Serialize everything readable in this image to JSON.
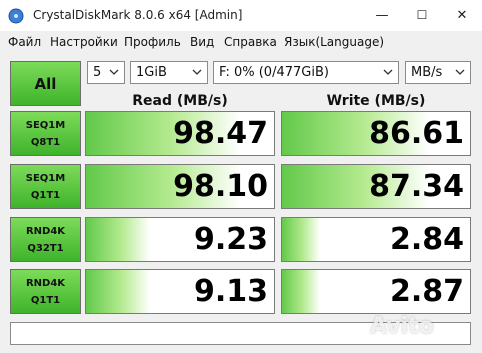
{
  "window": {
    "title": "CrystalDiskMark 8.0.6 x64 [Admin]",
    "minimize": "—",
    "maximize": "☐",
    "close": "✕"
  },
  "menu": [
    {
      "label": "Файл"
    },
    {
      "label": "Настройки"
    },
    {
      "label": "Профиль"
    },
    {
      "label": "Вид"
    },
    {
      "label": "Справка"
    },
    {
      "label": "Язык(Language)"
    }
  ],
  "controls": {
    "all_label": "All",
    "count": "5",
    "size": "1GiB",
    "drive": "F: 0% (0/477GiB)",
    "unit": "MB/s"
  },
  "headers": {
    "read": "Read (MB/s)",
    "write": "Write (MB/s)"
  },
  "tests": [
    {
      "line1": "SEQ1M",
      "line2": "Q8T1",
      "read": "98.47",
      "write": "86.61",
      "read_fill": 0.82,
      "write_fill": 0.78
    },
    {
      "line1": "SEQ1M",
      "line2": "Q1T1",
      "read": "98.10",
      "write": "87.34",
      "read_fill": 0.82,
      "write_fill": 0.78
    },
    {
      "line1": "RND4K",
      "line2": "Q32T1",
      "read": "9.23",
      "write": "2.84",
      "read_fill": 0.34,
      "write_fill": 0.2
    },
    {
      "line1": "RND4K",
      "line2": "Q1T1",
      "read": "9.13",
      "write": "2.87",
      "read_fill": 0.34,
      "write_fill": 0.2
    }
  ],
  "comment": "",
  "watermark": "Avito"
}
